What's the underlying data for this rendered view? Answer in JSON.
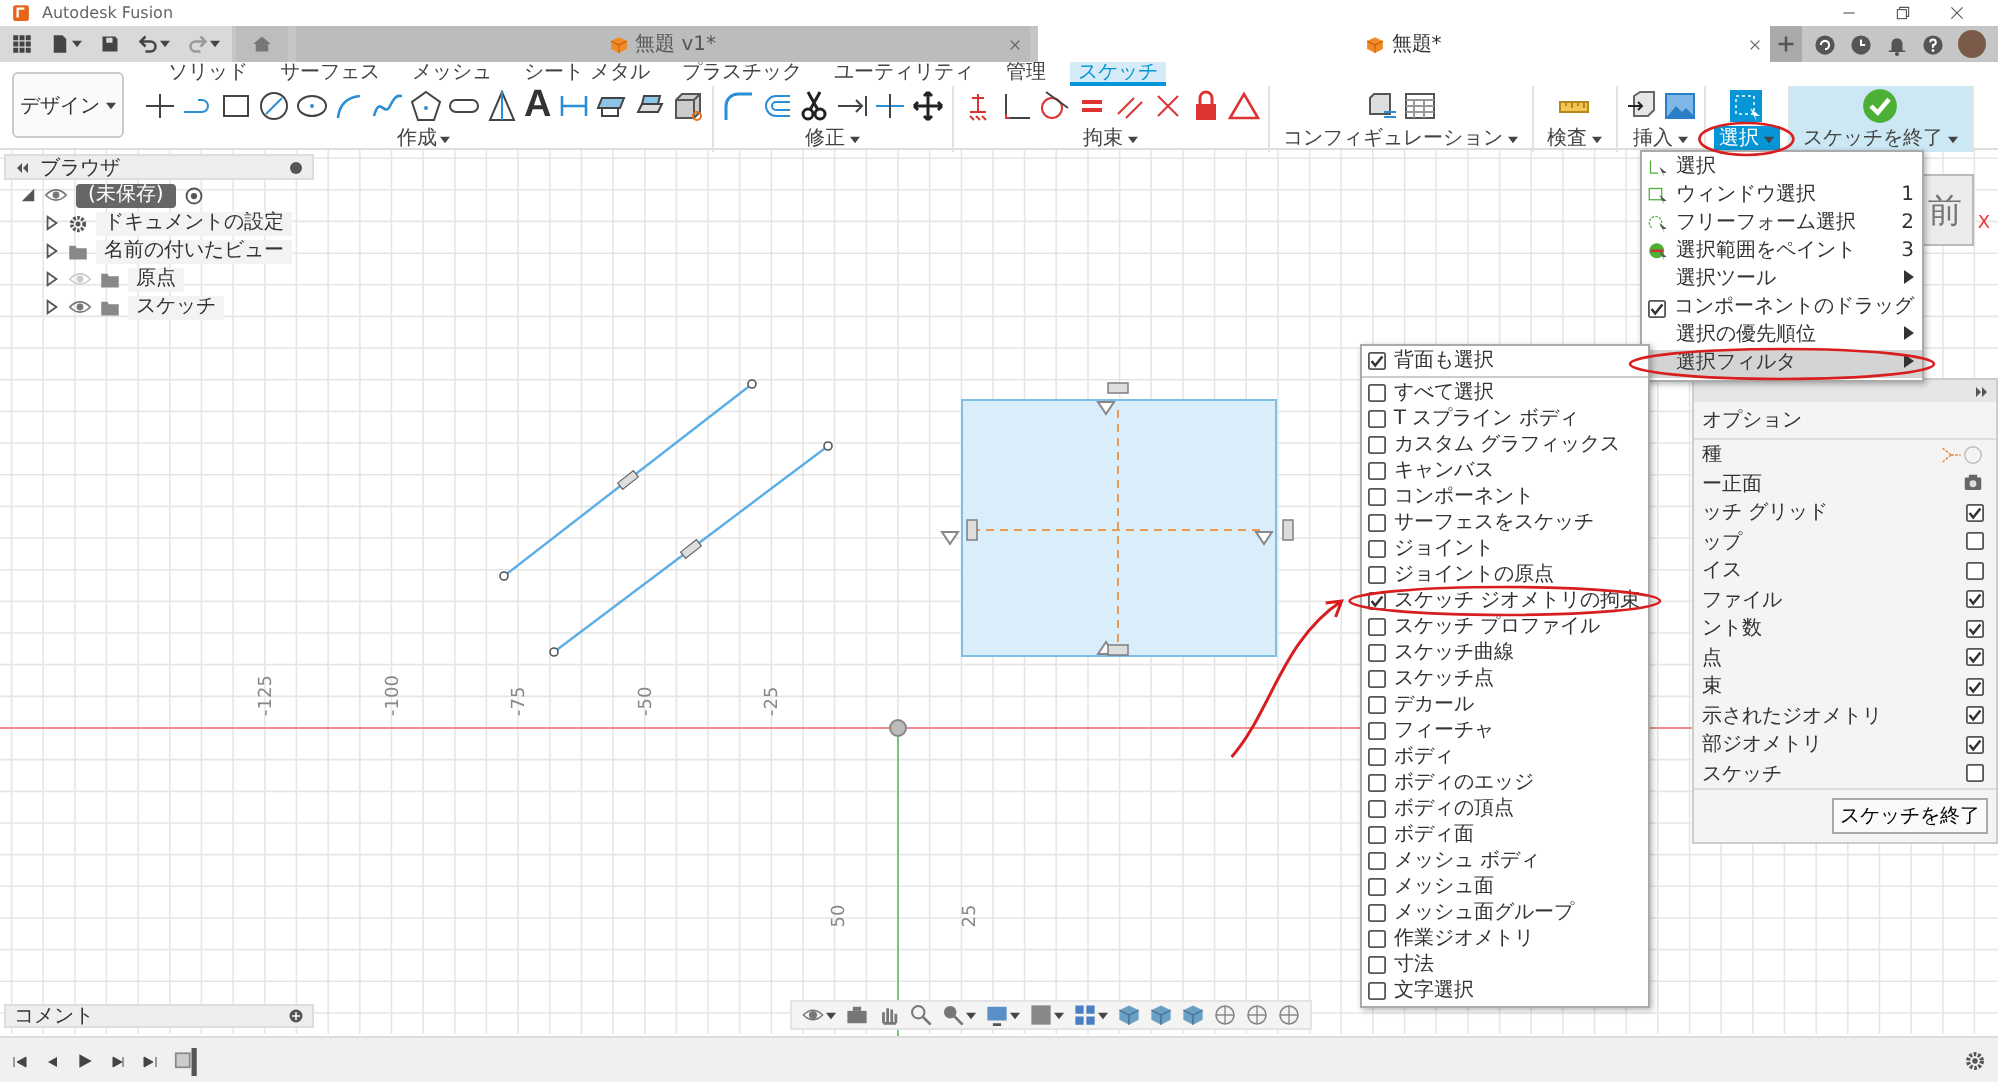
{
  "window": {
    "title": "Autodesk Fusion"
  },
  "document_tabs": [
    {
      "label": "無題 v1*",
      "selected": false
    },
    {
      "label": "無題*",
      "selected": true
    }
  ],
  "workspace": {
    "label": "デザイン"
  },
  "ribbon_tabs": [
    {
      "label": "ソリッド",
      "selected": false
    },
    {
      "label": "サーフェス",
      "selected": false
    },
    {
      "label": "メッシュ",
      "selected": false
    },
    {
      "label": "シート メタル",
      "selected": false
    },
    {
      "label": "プラスチック",
      "selected": false
    },
    {
      "label": "ユーティリティ",
      "selected": false
    },
    {
      "label": "管理",
      "selected": false
    },
    {
      "label": "スケッチ",
      "selected": true
    }
  ],
  "tool_groups": [
    {
      "kind": "create",
      "label": "作成",
      "glyph": "A",
      "selected": false
    },
    {
      "kind": "modify",
      "label": "修正",
      "selected": false
    },
    {
      "kind": "constraints",
      "label": "拘束",
      "selected": false
    },
    {
      "kind": "configure",
      "label": "コンフィギュレーション",
      "selected": false
    },
    {
      "kind": "inspect",
      "label": "検査",
      "selected": false
    },
    {
      "kind": "insert",
      "label": "挿入",
      "selected": false
    },
    {
      "kind": "select",
      "label": "選択",
      "selected": true
    },
    {
      "kind": "finish",
      "label": "スケッチを終了",
      "selected": false
    }
  ],
  "browser": {
    "title": "ブラウザ",
    "root": {
      "label": "(未保存)",
      "expanded": true,
      "visible": true,
      "children": [
        {
          "kind": "settings",
          "label": "ドキュメントの設定",
          "expanded": false
        },
        {
          "kind": "views",
          "label": "名前の付いたビュー",
          "expanded": false
        },
        {
          "kind": "folder",
          "label": "原点",
          "expanded": false,
          "visible": false
        },
        {
          "kind": "folder",
          "label": "スケッチ",
          "expanded": false,
          "visible": true
        }
      ]
    }
  },
  "selection_menu": {
    "items": [
      {
        "kind": "command",
        "label": "選択",
        "selected": false
      },
      {
        "kind": "command",
        "label": "ウィンドウ選択",
        "shortcut": "1",
        "selected": false
      },
      {
        "kind": "command",
        "label": "フリーフォーム選択",
        "shortcut": "2",
        "selected": false
      },
      {
        "kind": "command",
        "label": "選択範囲をペイント",
        "shortcut": "3",
        "selected": false
      },
      {
        "kind": "submenu",
        "label": "選択ツール",
        "selected": false
      },
      {
        "kind": "check",
        "label": "コンポーネントのドラッグ",
        "checked": true,
        "selected": false
      },
      {
        "kind": "submenu",
        "label": "選択の優先順位",
        "selected": false
      },
      {
        "kind": "submenu",
        "label": "選択フィルタ",
        "selected": true
      }
    ]
  },
  "selection_filters": {
    "items": [
      {
        "label": "背面も選択",
        "checked": true
      },
      {
        "label": "すべて選択",
        "checked": false
      },
      {
        "label": "T スプライン ボディ",
        "checked": false
      },
      {
        "label": "カスタム グラフィックス",
        "checked": false
      },
      {
        "label": "キャンバス",
        "checked": false
      },
      {
        "label": "コンポーネント",
        "checked": false
      },
      {
        "label": "サーフェスをスケッチ",
        "checked": false
      },
      {
        "label": "ジョイント",
        "checked": false
      },
      {
        "label": "ジョイントの原点",
        "checked": false
      },
      {
        "label": "スケッチ ジオメトリの拘束",
        "checked": true
      },
      {
        "label": "スケッチ プロファイル",
        "checked": false
      },
      {
        "label": "スケッチ曲線",
        "checked": false
      },
      {
        "label": "スケッチ点",
        "checked": false
      },
      {
        "label": "デカール",
        "checked": false
      },
      {
        "label": "フィーチャ",
        "checked": false
      },
      {
        "label": "ボディ",
        "checked": false
      },
      {
        "label": "ボディのエッジ",
        "checked": false
      },
      {
        "label": "ボディの頂点",
        "checked": false
      },
      {
        "label": "ボディ面",
        "checked": false
      },
      {
        "label": "メッシュ ボディ",
        "checked": false
      },
      {
        "label": "メッシュ面",
        "checked": false
      },
      {
        "label": "メッシュ面グループ",
        "checked": false
      },
      {
        "label": "作業ジオメトリ",
        "checked": false
      },
      {
        "label": "寸法",
        "checked": false
      },
      {
        "label": "文字選択",
        "checked": false
      }
    ]
  },
  "viewcube": {
    "face": "前",
    "axis": "X"
  },
  "sketch_palette": {
    "section": "オプション",
    "rows": [
      {
        "kind": "linetype",
        "label": "種"
      },
      {
        "kind": "look",
        "label": "ー正面"
      },
      {
        "kind": "check",
        "label": "ッチ グリッド",
        "checked": true
      },
      {
        "kind": "check",
        "label": "ップ",
        "checked": false
      },
      {
        "kind": "check",
        "label": "イス",
        "checked": false
      },
      {
        "kind": "check",
        "label": "ファイル",
        "checked": true
      },
      {
        "kind": "check",
        "label": "ント数",
        "checked": true
      },
      {
        "kind": "check",
        "label": "点",
        "checked": true
      },
      {
        "kind": "check",
        "label": "束",
        "checked": true
      },
      {
        "kind": "check",
        "label": "示されたジオメトリ",
        "checked": true
      },
      {
        "kind": "check",
        "label": "部ジオメトリ",
        "checked": true
      },
      {
        "kind": "check",
        "label": "スケッチ",
        "checked": false
      }
    ],
    "button": "スケッチを終了"
  },
  "canvas": {
    "x_labels": [
      "-125",
      "-100",
      "-75",
      "-50",
      "-25"
    ],
    "y_labels": [
      "25",
      "50"
    ]
  },
  "comments": {
    "title": "コメント"
  }
}
